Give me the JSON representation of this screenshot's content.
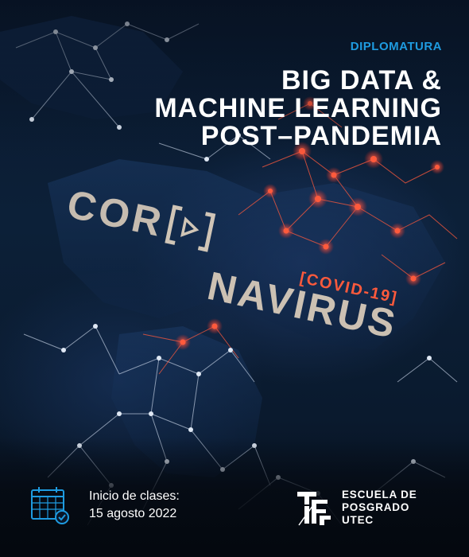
{
  "header": {
    "eyebrow": "DIPLOMATURA",
    "title_lines": [
      "BIG DATA &",
      "MACHINE LEARNING",
      "POST–PANDEMIA"
    ]
  },
  "background": {
    "word_part1": "COR",
    "word_part2": "NAVIRUS",
    "tag": "[COVID-19]"
  },
  "footer": {
    "dates_label": "Inicio de clases:",
    "dates_value": "15 agosto 2022",
    "calendar_icon": "calendar-icon",
    "school_lines": [
      "ESCUELA DE",
      "POSGRADO",
      "UTEC"
    ]
  },
  "colors": {
    "accent": "#1e9be0",
    "network": "#ff4a3a",
    "background": "#071426"
  }
}
